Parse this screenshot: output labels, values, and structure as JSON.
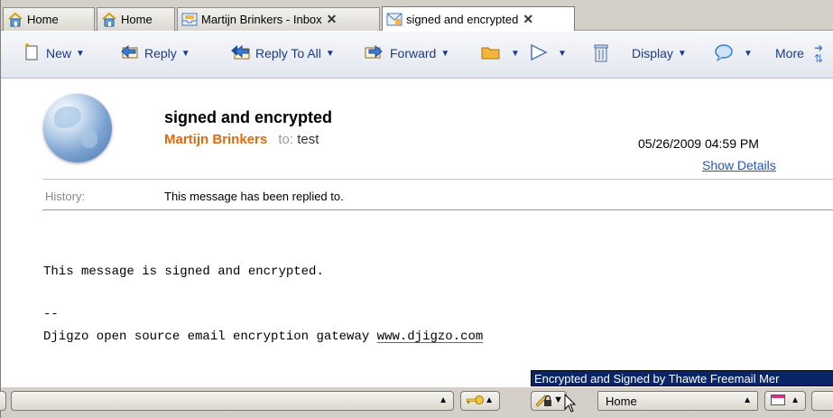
{
  "tabs": [
    {
      "label": "Home",
      "icon": "home-icon"
    },
    {
      "label": "Home",
      "icon": "home-icon"
    },
    {
      "label": "Martijn Brinkers - Inbox",
      "icon": "inbox-icon",
      "closable": true
    },
    {
      "label": "signed and encrypted",
      "icon": "message-icon",
      "closable": true,
      "active": true
    }
  ],
  "toolbar": {
    "new_label": "New",
    "reply_label": "Reply",
    "reply_all_label": "Reply To All",
    "forward_label": "Forward",
    "display_label": "Display",
    "more_label": "More"
  },
  "message": {
    "subject": "signed and encrypted",
    "sender": "Martijn Brinkers",
    "to_label": "to:",
    "recipient": "test",
    "date": "05/26/2009 04:59 PM",
    "show_details": "Show Details",
    "history_label": "History:",
    "history_text": "This message has been replied to.",
    "body_line1": "This message is signed and encrypted.",
    "body_sig_sep": "--",
    "body_sig_text": "Djigzo open source email encryption gateway ",
    "body_sig_link": "www.djigzo.com"
  },
  "tooltip": "Encrypted and Signed by Thawte Freemail Mer",
  "status": {
    "location": "Home"
  },
  "colors": {
    "sender": "#e06a10",
    "link": "#2255cc",
    "toolbar_text": "#1a3b8a",
    "tooltip_bg": "#0a2468"
  }
}
